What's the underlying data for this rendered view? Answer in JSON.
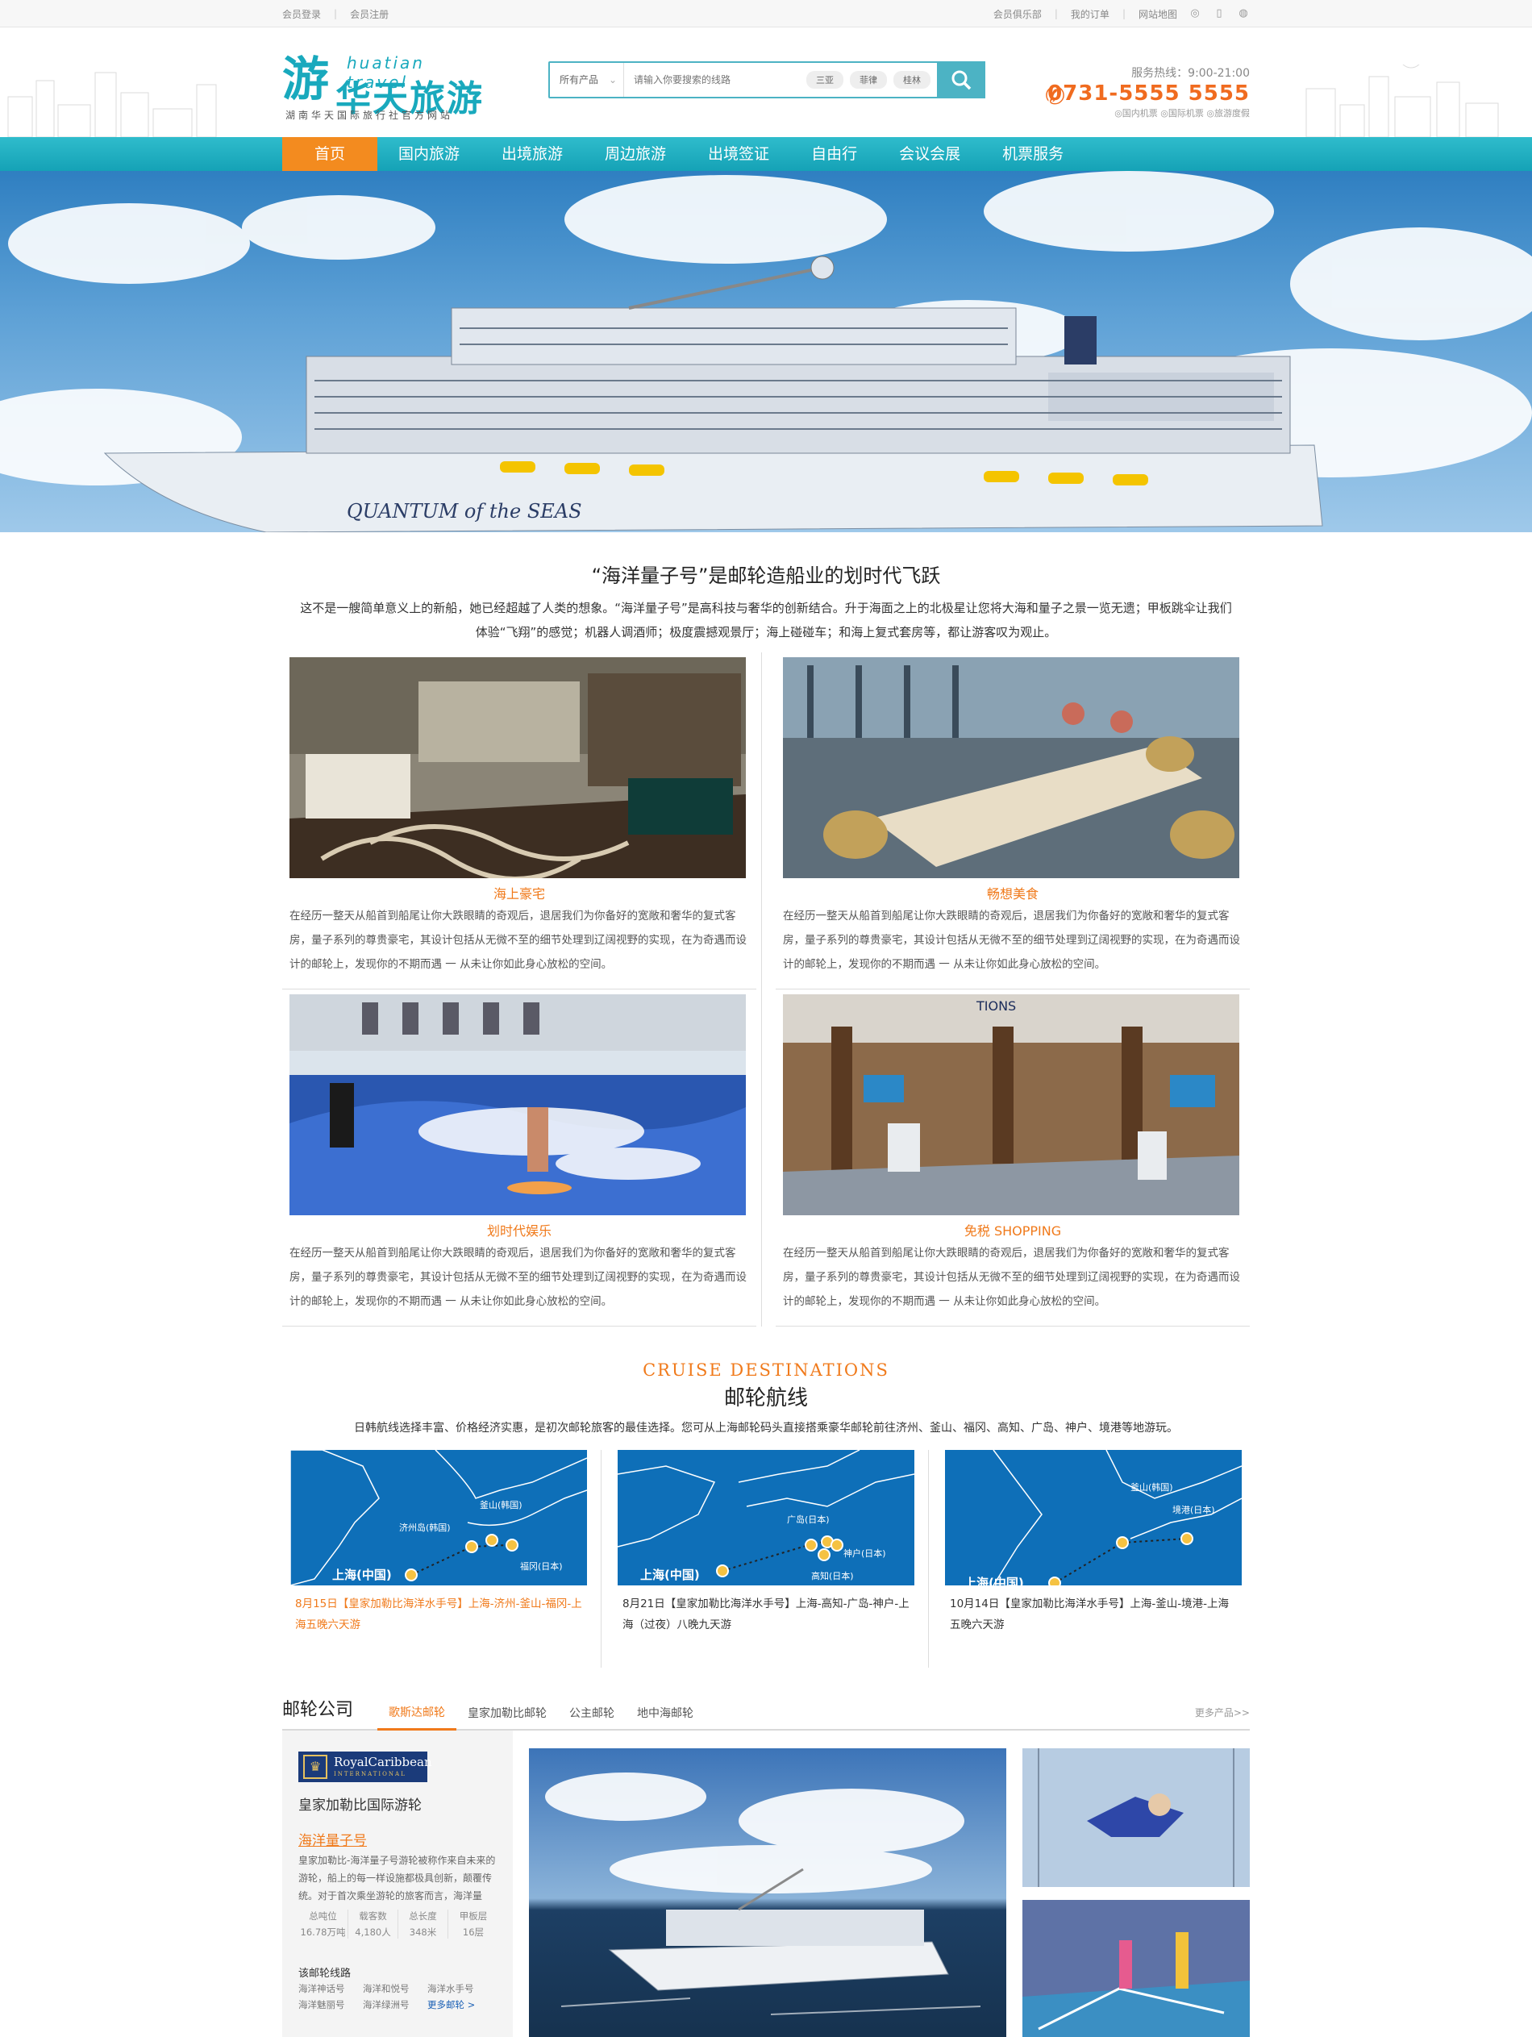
{
  "topbar": {
    "left": [
      "会员登录",
      "会员注册"
    ],
    "right": [
      "会员俱乐部",
      "我的订单",
      "网站地图"
    ],
    "icons": [
      "weibo-icon",
      "mobile-icon",
      "wechat-icon"
    ]
  },
  "header": {
    "logo_en": "huatian travel",
    "logo_cn": "华天旅游",
    "logo_sub": "湖南华天国际旅行社官方网站",
    "search": {
      "category": "所有产品",
      "placeholder": "请输入你要搜索的线路",
      "tags": [
        "三亚",
        "菲律",
        "桂林"
      ]
    },
    "hotline_label": "服务热线：9:00-21:00",
    "hotline_number": "0731-5555 5555",
    "hotline_links": "◎国内机票 ◎国际机票 ◎旅游度假"
  },
  "nav": [
    "首页",
    "国内旅游",
    "出境旅游",
    "周边旅游",
    "出境签证",
    "自由行",
    "会议会展",
    "机票服务"
  ],
  "banner": {
    "ship_name": "QUANTUM of the SEAS"
  },
  "intro": {
    "title": "“海洋量子号”是邮轮造船业的划时代飞跃",
    "text": "这不是一艘简单意义上的新船，她已经超越了人类的想象。“海洋量子号”是高科技与奢华的创新结合。升于海面之上的北极星让您将大海和量子之景一览无遗；甲板跳伞让我们体验“飞翔”的感觉；机器人调酒师；极度震撼观景厅；海上碰碰车；和海上复式套房等，都让游客叹为观止。"
  },
  "features": [
    {
      "title": "海上豪宅",
      "text": "在经历一整天从船首到船尾让你大跌眼睛的奇观后，退居我们为你备好的宽敞和奢华的复式客房，量子系列的尊贵豪宅，其设计包括从无微不至的细节处理到辽阔视野的实现，在为奇遇而设计的邮轮上，发现你的不期而遇 一 从未让你如此身心放松的空间。"
    },
    {
      "title": "畅想美食",
      "text": "在经历一整天从船首到船尾让你大跌眼睛的奇观后，退居我们为你备好的宽敞和奢华的复式客房，量子系列的尊贵豪宅，其设计包括从无微不至的细节处理到辽阔视野的实现，在为奇遇而设计的邮轮上，发现你的不期而遇 一 从未让你如此身心放松的空间。"
    },
    {
      "title": "划时代娱乐",
      "text": "在经历一整天从船首到船尾让你大跌眼睛的奇观后，退居我们为你备好的宽敞和奢华的复式客房，量子系列的尊贵豪宅，其设计包括从无微不至的细节处理到辽阔视野的实现，在为奇遇而设计的邮轮上，发现你的不期而遇 一 从未让你如此身心放松的空间。"
    },
    {
      "title": "免税 SHOPPING",
      "text": "在经历一整天从船首到船尾让你大跌眼睛的奇观后，退居我们为你备好的宽敞和奢华的复式客房，量子系列的尊贵豪宅，其设计包括从无微不至的细节处理到辽阔视野的实现，在为奇遇而设计的邮轮上，发现你的不期而遇 一 从未让你如此身心放松的空间。"
    }
  ],
  "destinations": {
    "en": "CRUISE DESTINATIONS",
    "cn": "邮轮航线",
    "text": "日韩航线选择丰富、价格经济实惠，是初次邮轮旅客的最佳选择。您可从上海邮轮码头直接搭乘豪华邮轮前往济州、釜山、福冈、高知、广岛、神户、境港等地游玩。",
    "routes": [
      {
        "labels": [
          "上海(中国)",
          "济州岛(韩国)",
          "釜山(韩国)",
          "福冈(日本)"
        ],
        "text": "8月15日【皇家加勒比海洋水手号】上海-济州-釜山-福冈-上海五晚六天游"
      },
      {
        "labels": [
          "上海(中国)",
          "广岛(日本)",
          "神户(日本)",
          "高知(日本)"
        ],
        "text": "8月21日【皇家加勒比海洋水手号】上海-高知-广岛-神户-上海（过夜）八晚九天游"
      },
      {
        "labels": [
          "上海(中国)",
          "釜山(韩国)",
          "境港(日本)"
        ],
        "text": "10月14日【皇家加勒比海洋水手号】上海-釜山-境港-上海五晚六天游"
      }
    ]
  },
  "companies": {
    "title": "邮轮公司",
    "tabs": [
      "歌斯达邮轮",
      "皇家加勒比邮轮",
      "公主邮轮",
      "地中海邮轮"
    ],
    "more": "更多产品>>",
    "brand_main": "RoyalCaribbean",
    "brand_sub": "INTERNATIONAL",
    "name": "皇家加勒比国际游轮",
    "ship": "海洋量子号",
    "desc": "皇家加勒比-海洋量子号游轮被称作来自未来的游轮，船上的每一样设施都极具创新，颠覆传统。对于首次乘坐游轮的旅客而言，海洋量",
    "stats": [
      {
        "k": "总吨位",
        "v": "16.78万吨"
      },
      {
        "k": "载客数",
        "v": "4,180人"
      },
      {
        "k": "总长度",
        "v": "348米"
      },
      {
        "k": "甲板层",
        "v": "16层"
      }
    ],
    "routes_label": "该邮轮线路",
    "routes": [
      "海洋神话号",
      "海洋和悦号",
      "海洋水手号",
      "海洋魅丽号",
      "海洋绿洲号",
      "更多邮轮 >"
    ]
  }
}
